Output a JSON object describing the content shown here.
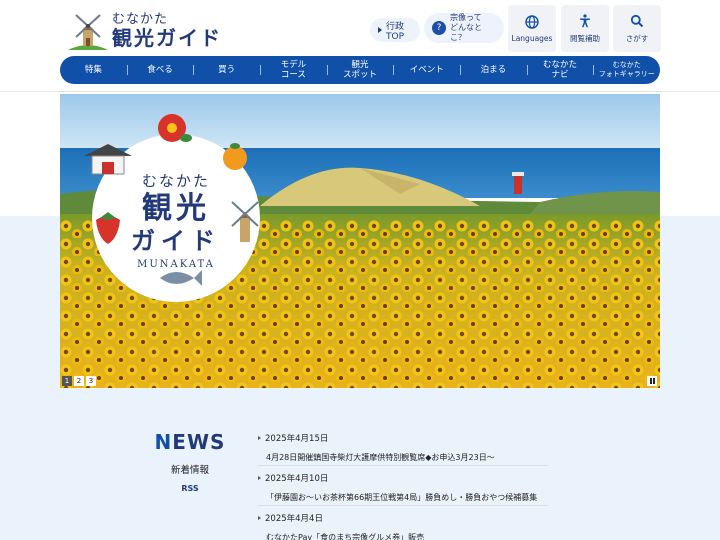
{
  "header": {
    "logo_small": "むなかた",
    "logo_big": "観光ガイド",
    "gov_link": "行政TOP",
    "question_link": "宗像って\nどんなとこ？",
    "languages_label": "Languages",
    "accessibility_label": "閲覧補助",
    "search_label": "さがす"
  },
  "nav": {
    "items": [
      "特集",
      "食べる",
      "買う",
      "モデル\nコース",
      "観光\nスポット",
      "イベント",
      "泊まる",
      "むなかた\nナビ",
      "むなかた\nフォトギャラリー"
    ]
  },
  "hero": {
    "badge_small": "むなかた",
    "badge_big": "観光",
    "badge_big2": "ガイド",
    "badge_en": "MUNAKATA",
    "slides": [
      "1",
      "2",
      "3"
    ],
    "active_slide": 1
  },
  "news": {
    "title_first": "N",
    "title_rest": "EWS",
    "subtitle": "新着情報",
    "rss": "RSS",
    "items": [
      {
        "date": "2025年4月15日",
        "text": "4月28日開催鎮国寺柴灯大護摩供特別観覧席◆お申込3月23日～"
      },
      {
        "date": "2025年4月10日",
        "text": "「伊藤園お～いお茶杯第66期王位戦第4局」勝負めし・勝負おやつ候補募集"
      },
      {
        "date": "2025年4月4日",
        "text": "むなかたPay「食のまち宗像グルメ券」販売"
      }
    ]
  },
  "colors": {
    "primary": "#1150a8",
    "navy": "#233a7a",
    "band": "#eaf2fb"
  }
}
